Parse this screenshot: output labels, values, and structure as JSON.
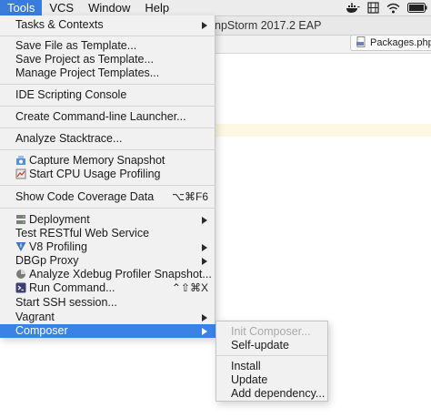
{
  "menubar": {
    "items": [
      "Tools",
      "VCS",
      "Window",
      "Help"
    ],
    "active_index": 0,
    "status_icons": [
      "docker-whale-icon",
      "film-strip-icon",
      "wifi-icon",
      "battery-icon"
    ]
  },
  "ide": {
    "title": "npStorm 2017.2 EAP",
    "open_file_tab": "Packages.php"
  },
  "tools_menu": {
    "items": {
      "tasks_contexts": "Tasks & Contexts",
      "save_file_template": "Save File as Template...",
      "save_project_template": "Save Project as Template...",
      "manage_project_templates": "Manage Project Templates...",
      "ide_scripting_console": "IDE Scripting Console",
      "create_cli_launcher": "Create Command-line Launcher...",
      "analyze_stacktrace": "Analyze Stacktrace...",
      "capture_memory_snapshot": "Capture Memory Snapshot",
      "start_cpu_profiling": "Start CPU Usage Profiling",
      "show_code_coverage": "Show Code Coverage Data",
      "show_code_coverage_shortcut": "⌥⌘F6",
      "deployment": "Deployment",
      "test_restful": "Test RESTful Web Service",
      "v8_profiling": "V8 Profiling",
      "dbgp_proxy": "DBGp Proxy",
      "analyze_xdebug": "Analyze Xdebug Profiler Snapshot...",
      "run_command": "Run Command...",
      "run_command_shortcut": "⌃⇧⌘X",
      "start_ssh": "Start SSH session...",
      "vagrant": "Vagrant",
      "composer": "Composer"
    }
  },
  "composer_submenu": {
    "init_composer": "Init Composer...",
    "self_update": "Self-update",
    "install": "Install",
    "update": "Update",
    "add_dependency": "Add dependency..."
  },
  "colors": {
    "highlight": "#3a82e6",
    "menu_bg": "#f1f1f1",
    "disabled_text": "#a9a9a9"
  }
}
